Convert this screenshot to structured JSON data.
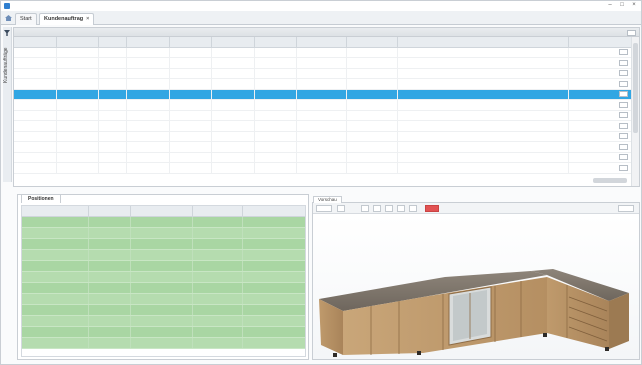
{
  "window": {
    "title": ""
  },
  "tabs": {
    "home_label": "Start",
    "active_label": "Kundenauftrag",
    "close_glyph": "×"
  },
  "sidebar": {
    "label": "Kundenaufträge"
  },
  "orders": {
    "header_title": "",
    "header_tool": "",
    "columns": [
      "",
      "",
      "",
      "",
      "",
      "",
      "",
      "",
      "",
      "",
      ""
    ],
    "rows": [
      [
        "",
        "",
        "",
        "",
        "",
        "",
        "",
        "",
        "",
        "",
        ""
      ],
      [
        "",
        "",
        "",
        "",
        "",
        "",
        "",
        "",
        "",
        "",
        ""
      ],
      [
        "",
        "",
        "",
        "",
        "",
        "",
        "",
        "",
        "",
        "",
        ""
      ],
      [
        "",
        "",
        "",
        "",
        "",
        "",
        "",
        "",
        "",
        "",
        ""
      ],
      [
        "",
        "",
        "",
        "",
        "",
        "",
        "",
        "",
        "",
        "",
        ""
      ],
      [
        "",
        "",
        "",
        "",
        "",
        "",
        "",
        "",
        "",
        "",
        ""
      ],
      [
        "",
        "",
        "",
        "",
        "",
        "",
        "",
        "",
        "",
        "",
        ""
      ],
      [
        "",
        "",
        "",
        "",
        "",
        "",
        "",
        "",
        "",
        "",
        ""
      ],
      [
        "",
        "",
        "",
        "",
        "",
        "",
        "",
        "",
        "",
        "",
        ""
      ],
      [
        "",
        "",
        "",
        "",
        "",
        "",
        "",
        "",
        "",
        "",
        ""
      ],
      [
        "",
        "",
        "",
        "",
        "",
        "",
        "",
        "",
        "",
        "",
        ""
      ],
      [
        "",
        "",
        "",
        "",
        "",
        "",
        "",
        "",
        "",
        "",
        ""
      ]
    ],
    "selected_row": 4,
    "selection_color": "#31a6e3"
  },
  "positions": {
    "tab_label": "Positionen",
    "columns": [
      "",
      "",
      "",
      "",
      ""
    ],
    "rows": [
      [
        "",
        "",
        "",
        "",
        ""
      ],
      [
        "",
        "",
        "",
        "",
        ""
      ],
      [
        "",
        "",
        "",
        "",
        ""
      ],
      [
        "",
        "",
        "",
        "",
        ""
      ],
      [
        "",
        "",
        "",
        "",
        ""
      ],
      [
        "",
        "",
        "",
        "",
        ""
      ],
      [
        "",
        "",
        "",
        "",
        ""
      ],
      [
        "",
        "",
        "",
        "",
        ""
      ],
      [
        "",
        "",
        "",
        "",
        ""
      ],
      [
        "",
        "",
        "",
        "",
        ""
      ],
      [
        "",
        "",
        "",
        "",
        ""
      ],
      [
        "",
        "",
        "",
        "",
        ""
      ]
    ],
    "row_color": "#a9d6a3"
  },
  "preview": {
    "tab_label": "Vorschau",
    "toolbar_accent": "#e25252"
  },
  "icons": {
    "home": "home-icon",
    "filter": "filter-icon",
    "kitchen_model": "kitchen-model-icon"
  }
}
